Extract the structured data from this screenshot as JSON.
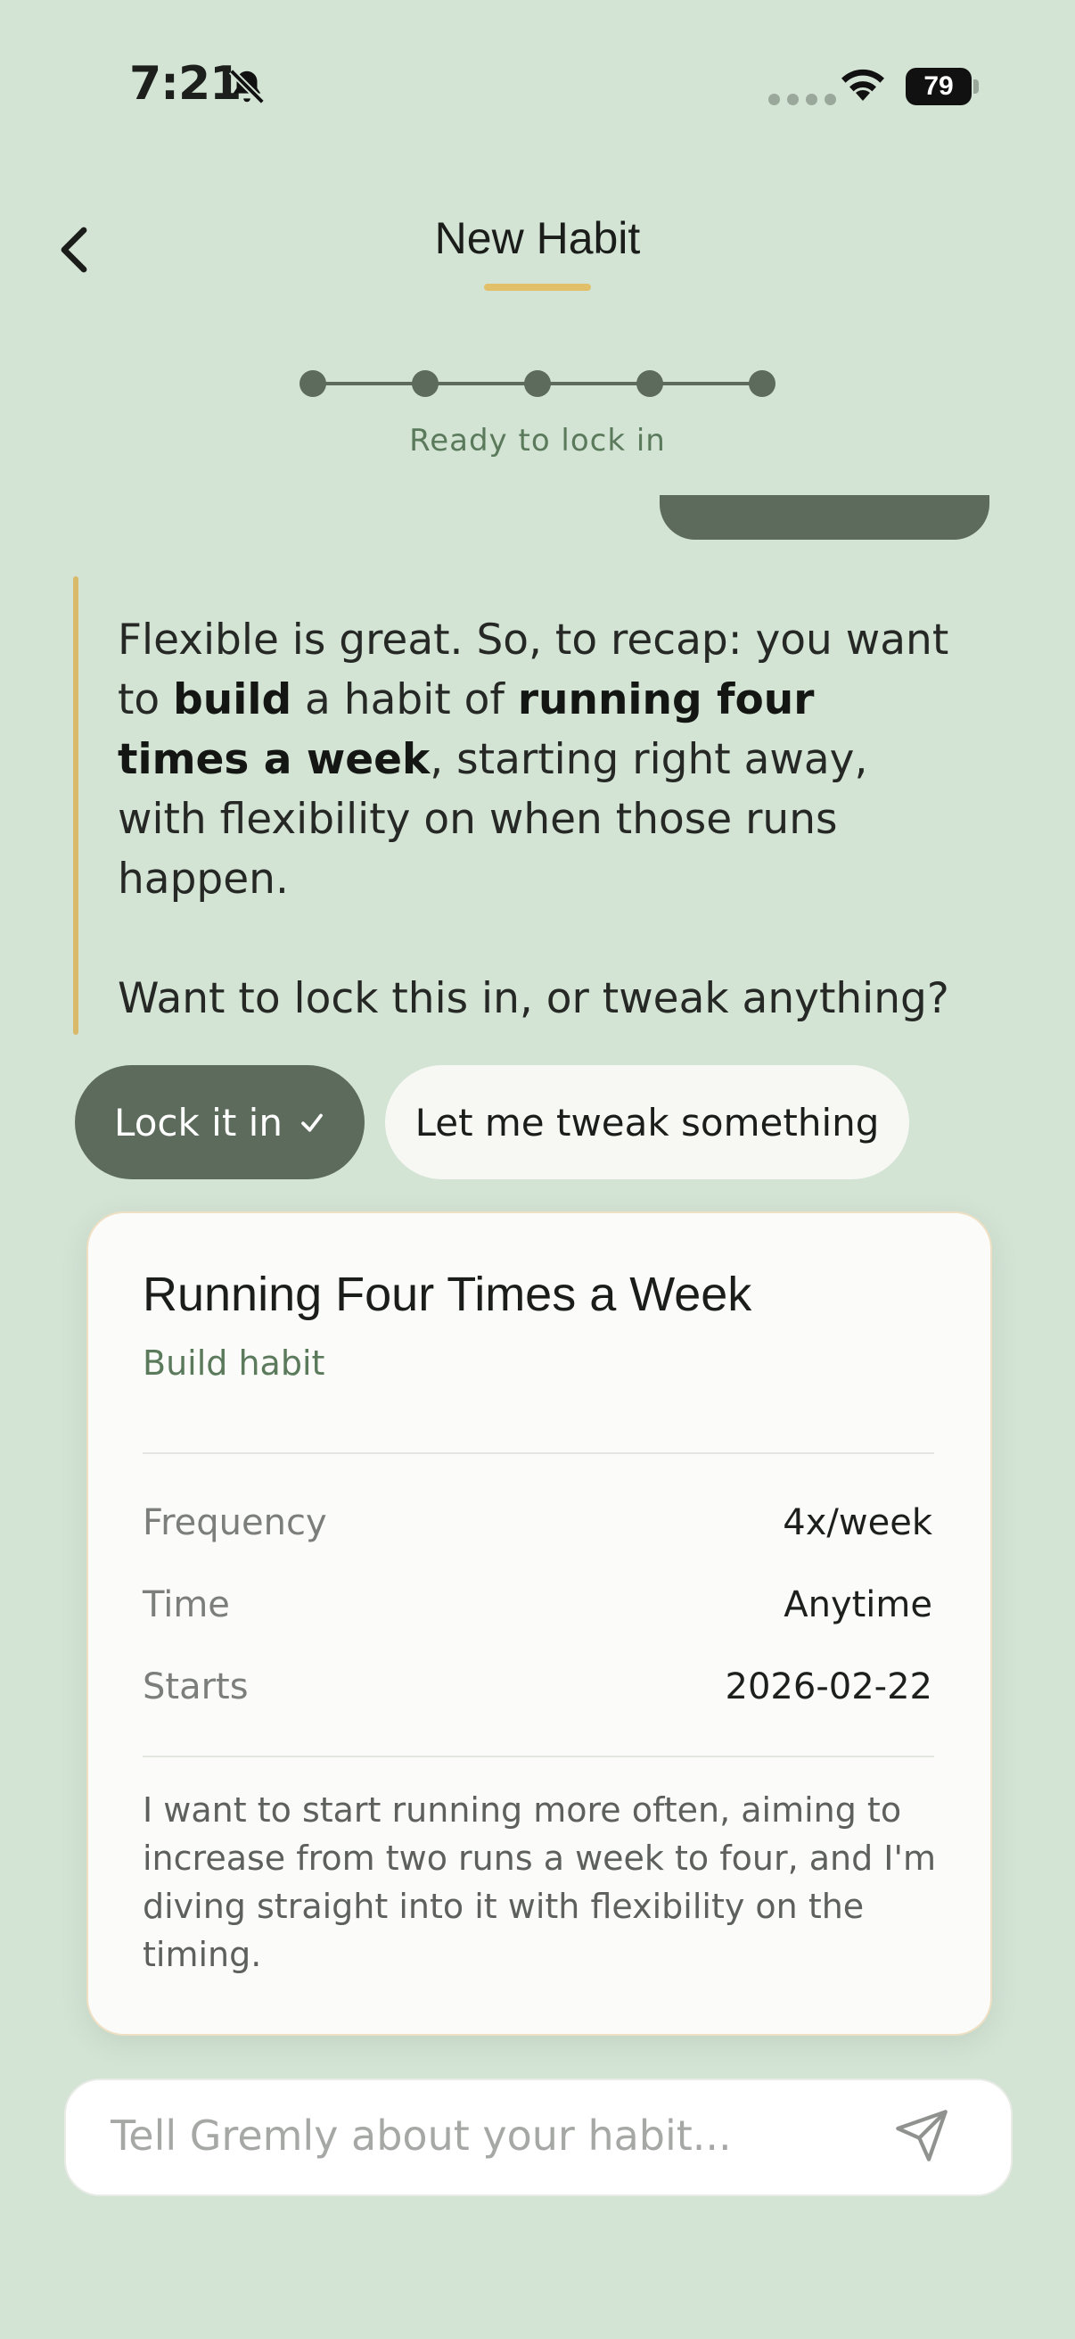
{
  "status": {
    "time": "7:21",
    "battery": "79"
  },
  "header": {
    "title": "New Habit",
    "step_label": "Ready to lock in",
    "steps_total": 5,
    "steps_completed": 5
  },
  "message": {
    "p1": [
      {
        "text": "Flexible is great. So, to recap: you want to ",
        "bold": false
      },
      {
        "text": "build",
        "bold": true
      },
      {
        "text": " a habit of ",
        "bold": false
      },
      {
        "text": "running four times a week",
        "bold": true
      },
      {
        "text": ", starting right away, with flexibility on when those runs happen.",
        "bold": false
      }
    ],
    "p2": "Want to lock this in, or tweak anything?"
  },
  "quick_replies": {
    "primary": "Lock it in",
    "secondary": "Let me tweak something"
  },
  "habit_card": {
    "title": "Running Four Times a Week",
    "type": "Build habit",
    "rows": [
      {
        "label": "Frequency",
        "value": "4x/week"
      },
      {
        "label": "Time",
        "value": "Anytime"
      },
      {
        "label": "Starts",
        "value": "2026-02-22"
      }
    ],
    "description": "I want to start running more often, aiming to increase from two runs a week to four, and I'm diving straight into it with flexibility on the timing."
  },
  "composer": {
    "placeholder": "Tell Gremly about your habit...",
    "value": ""
  },
  "colors": {
    "accent": "#5c6b5b",
    "highlight": "#e2c06a",
    "background": "#d3e3d4"
  }
}
